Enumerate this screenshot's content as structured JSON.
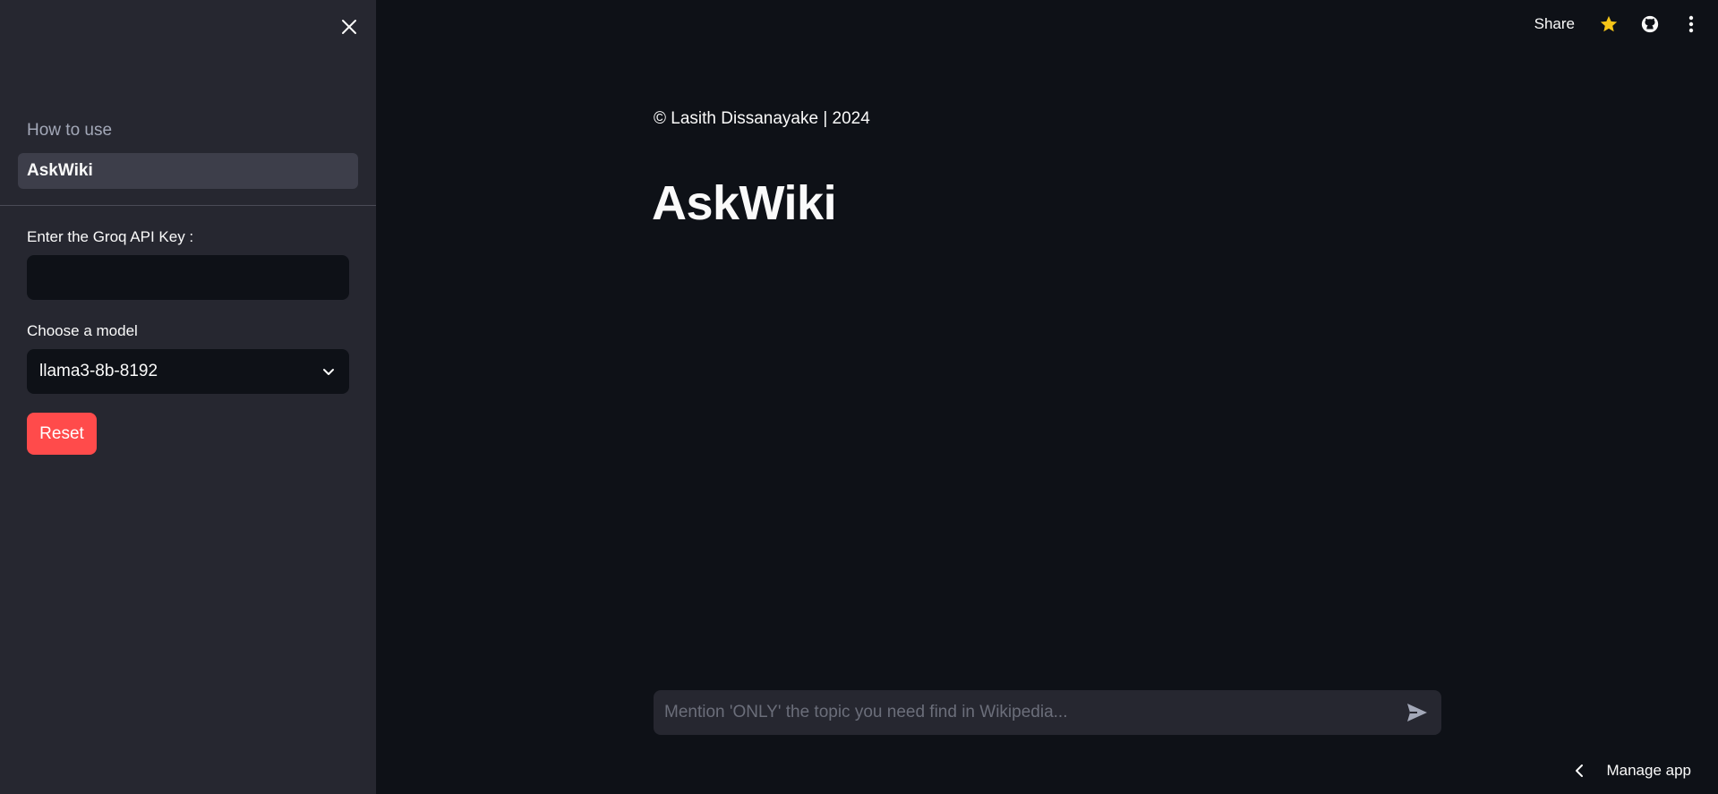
{
  "sidebar": {
    "nav": [
      {
        "label": "How to use"
      },
      {
        "label": "AskWiki"
      }
    ],
    "api_key_label": "Enter the Groq API Key :",
    "api_key_value": "",
    "model_label": "Choose a model",
    "model_selected": "llama3-8b-8192",
    "reset_label": "Reset"
  },
  "header": {
    "share_label": "Share",
    "icons": [
      "star-icon",
      "github-icon",
      "more-vert-icon"
    ]
  },
  "main": {
    "copyright": "© Lasith Dissanayake | 2024",
    "title": "AskWiki",
    "chat_placeholder": "Mention 'ONLY' the topic you need find in Wikipedia..."
  },
  "footer": {
    "manage_label": "Manage app"
  },
  "colors": {
    "background": "#0e1117",
    "sidebar": "#262730",
    "accent": "#ff4b4b",
    "star": "#f5c518"
  }
}
